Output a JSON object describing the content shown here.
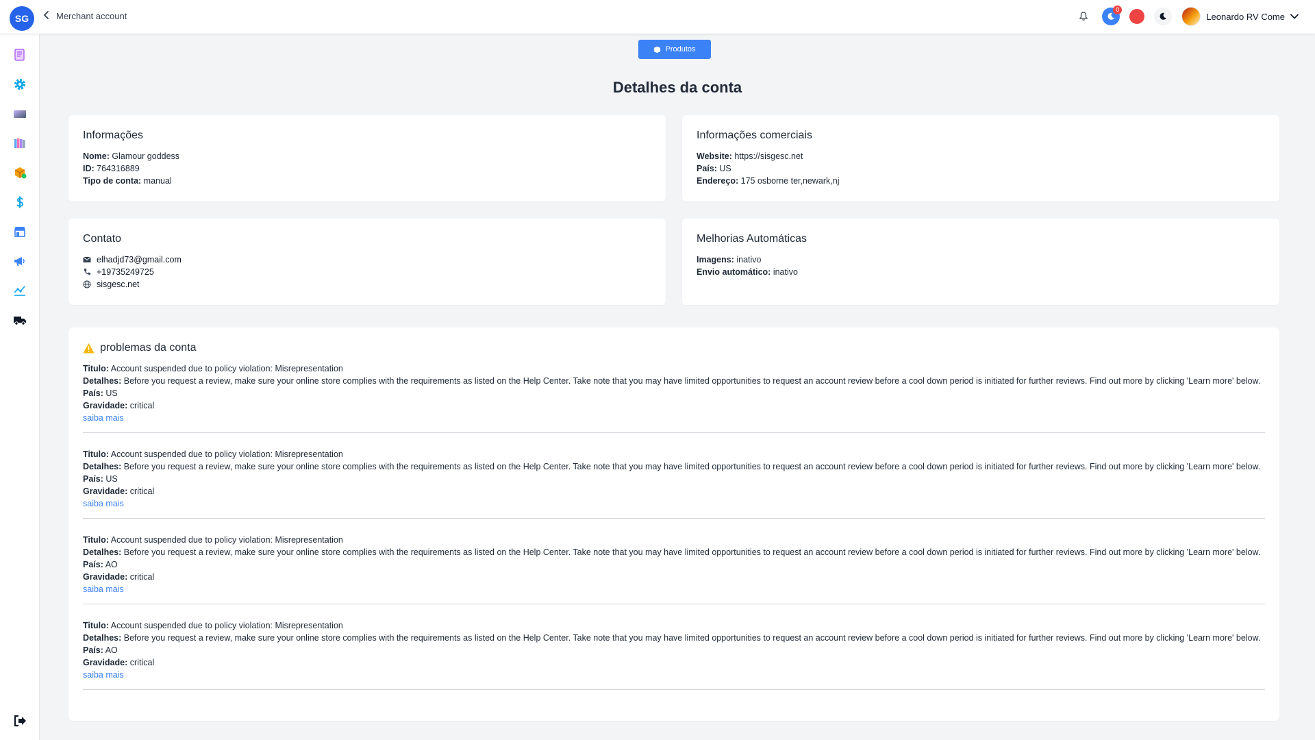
{
  "header": {
    "logo_text": "SG",
    "back_label": "Merchant account",
    "notification_count": "0",
    "user_name": "Leonardo RV Come"
  },
  "sidebar": {
    "items": [
      "scroll-icon",
      "gear-icon",
      "gradient-card-icon",
      "books-icon",
      "box-icon",
      "dollar-icon",
      "store-icon",
      "megaphone-icon",
      "analytics-icon",
      "truck-icon"
    ],
    "logout": "logout-icon"
  },
  "toolbar": {
    "products_label": "Produtos"
  },
  "page": {
    "title": "Detalhes da conta"
  },
  "info": {
    "title": "Informações",
    "name_label": "Nome:",
    "name": "Glamour goddess",
    "id_label": "ID:",
    "id": "764316889",
    "type_label": "Tipo de conta:",
    "type": "manual"
  },
  "commercial": {
    "title": "Informações comerciais",
    "website_label": "Website:",
    "website": "https://sisgesc.net",
    "country_label": "País:",
    "country": "US",
    "address_label": "Endereço:",
    "address": "175 osborne ter,newark,nj"
  },
  "contact": {
    "title": "Contato",
    "email": "elhadjd73@gmail.com",
    "phone": "+19735249725",
    "site": "sisgesc.net"
  },
  "auto": {
    "title": "Melhorias Automáticas",
    "images_label": "Imagens:",
    "images": "inativo",
    "shipping_label": "Envio automático:",
    "shipping": "inativo"
  },
  "issues": {
    "title": "problemas da conta",
    "title_label": "Titulo:",
    "details_label": "Detalhes:",
    "country_label": "País:",
    "severity_label": "Gravidade:",
    "learn_label": "saiba mais",
    "list": [
      {
        "title": "Account suspended due to policy violation: Misrepresentation",
        "details": "Before you request a review, make sure your online store complies with the requirements as listed on the Help Center. Take note that you may have limited opportunities to request an account review before a cool down period is initiated for further reviews. Find out more by clicking 'Learn more' below.",
        "country": "US",
        "severity": "critical"
      },
      {
        "title": "Account suspended due to policy violation: Misrepresentation",
        "details": "Before you request a review, make sure your online store complies with the requirements as listed on the Help Center. Take note that you may have limited opportunities to request an account review before a cool down period is initiated for further reviews. Find out more by clicking 'Learn more' below.",
        "country": "US",
        "severity": "critical"
      },
      {
        "title": "Account suspended due to policy violation: Misrepresentation",
        "details": "Before you request a review, make sure your online store complies with the requirements as listed on the Help Center. Take note that you may have limited opportunities to request an account review before a cool down period is initiated for further reviews. Find out more by clicking 'Learn more' below.",
        "country": "AO",
        "severity": "critical"
      },
      {
        "title": "Account suspended due to policy violation: Misrepresentation",
        "details": "Before you request a review, make sure your online store complies with the requirements as listed on the Help Center. Take note that you may have limited opportunities to request an account review before a cool down period is initiated for further reviews. Find out more by clicking 'Learn more' below.",
        "country": "AO",
        "severity": "critical"
      }
    ]
  },
  "colors": {
    "accent": "#3b82f6",
    "logo": "#2563eb",
    "danger": "#ef4444",
    "warning": "#f5b700"
  }
}
